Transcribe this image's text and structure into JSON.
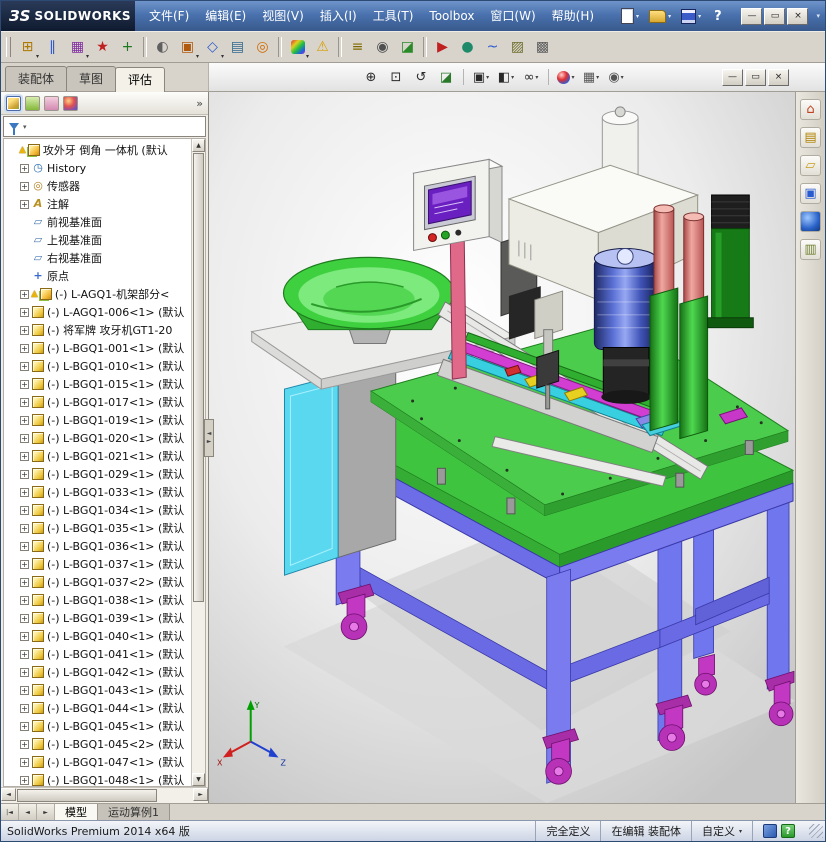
{
  "colors": {
    "titlebar_blue": "#4a72ae",
    "table_green": "#3fc43f",
    "frame_blue": "#7b7bf0",
    "caster_magenta": "#c238c2",
    "status_help_green": "#2a9a2a",
    "feeder_green": "#3fd03f",
    "motor_blue": "#5a6fd4",
    "door_cyan": "#5ad8f0"
  },
  "glyphs": {
    "caret": "▾",
    "overflow": "»",
    "up": "▲",
    "down": "▼",
    "left": "◄",
    "right": "►",
    "split_left": "◄",
    "split_right": "►"
  },
  "titlebar": {
    "brand_mark": "ЗS",
    "brand_name": "SOLIDWORKS",
    "menus": [
      "文件(F)",
      "编辑(E)",
      "视图(V)",
      "插入(I)",
      "工具(T)",
      "Toolbox",
      "窗口(W)",
      "帮助(H)"
    ],
    "quick_icons": [
      {
        "name": "new-document-button",
        "kind": "doc"
      },
      {
        "name": "open-document-button",
        "kind": "folder"
      },
      {
        "name": "save-button",
        "kind": "save"
      }
    ],
    "help_label": "?",
    "window_buttons": [
      "—",
      "▭",
      "×"
    ],
    "trailing_caret": "▾"
  },
  "toolbar": {
    "icons": [
      {
        "name": "insert-components-button",
        "glyph": "⊞",
        "color": "#b07800",
        "caret": true
      },
      {
        "name": "mate-button",
        "glyph": "∥",
        "color": "#2a5ad0"
      },
      {
        "name": "linear-component-pattern-button",
        "glyph": "▦",
        "color": "#8030a0",
        "caret": true
      },
      {
        "name": "smart-fasteners-button",
        "glyph": "★",
        "color": "#c02020"
      },
      {
        "name": "move-component-button",
        "glyph": "+",
        "color": "#207820"
      },
      {
        "sep": true
      },
      {
        "name": "show-hidden-components-button",
        "glyph": "◐",
        "color": "#606060"
      },
      {
        "name": "assembly-features-button",
        "glyph": "▣",
        "color": "#b05a10",
        "caret": true
      },
      {
        "name": "reference-geometry-button",
        "glyph": "◇",
        "color": "#2a5ad0",
        "caret": true
      },
      {
        "name": "bill-of-materials-button",
        "glyph": "▤",
        "color": "#306890"
      },
      {
        "name": "exploded-view-button",
        "glyph": "◎",
        "color": "#d06a00"
      },
      {
        "sep": true
      },
      {
        "name": "edit-appearance-button",
        "rainbow": true,
        "glyph": "",
        "caret": true
      },
      {
        "name": "interference-detection-button",
        "glyph": "⚠",
        "color": "#d8a000"
      },
      {
        "sep": true
      },
      {
        "name": "measure-button",
        "glyph": "≡",
        "color": "#806a00"
      },
      {
        "name": "mass-properties-button",
        "glyph": "◉",
        "color": "#505050"
      },
      {
        "name": "section-view-button",
        "glyph": "◪",
        "color": "#2a8a2a"
      },
      {
        "sep": true
      },
      {
        "name": "simulationxpress-button",
        "glyph": "▶",
        "color": "#c02020"
      },
      {
        "name": "motion-study-button",
        "glyph": "●",
        "color": "#1f8a6a"
      },
      {
        "name": "curves-button",
        "glyph": "~",
        "color": "#2a5ad0"
      },
      {
        "name": "toolbox-button",
        "glyph": "▨",
        "color": "#707030"
      },
      {
        "name": "options-button",
        "glyph": "▩",
        "color": "#606060"
      }
    ]
  },
  "command_tabs": {
    "items": [
      "装配体",
      "草图",
      "评估"
    ],
    "active_index": 2
  },
  "headsup": {
    "icons": [
      {
        "name": "zoom-to-fit-button",
        "glyph": "⊕",
        "color": "#2a2a2a"
      },
      {
        "name": "zoom-to-area-button",
        "glyph": "⊡",
        "color": "#2a2a2a"
      },
      {
        "name": "previous-view-button",
        "glyph": "↺",
        "color": "#2a2a2a"
      },
      {
        "name": "section-view-button",
        "glyph": "◪",
        "color": "#2a7a2a"
      },
      {
        "sep": true
      },
      {
        "name": "view-orientation-button",
        "glyph": "▣",
        "color": "#2a2a2a",
        "caret": true
      },
      {
        "name": "display-style-button",
        "glyph": "◧",
        "color": "#2a2a2a",
        "caret": true
      },
      {
        "name": "hide-show-items-button",
        "glyph": "∞",
        "color": "#2a2a2a",
        "caret": true
      },
      {
        "sep": true
      },
      {
        "name": "edit-appearance-button",
        "ball": true,
        "glyph": "",
        "caret": true
      },
      {
        "name": "apply-scene-button",
        "glyph": "▦",
        "color": "#555",
        "caret": true
      },
      {
        "name": "view-settings-button",
        "glyph": "◉",
        "color": "#555",
        "caret": true
      }
    ]
  },
  "child_window_buttons": [
    "—",
    "▭",
    "×"
  ],
  "feature_panel": {
    "tabs": [
      {
        "name": "featuremanager-tab"
      },
      {
        "name": "propertymanager-tab"
      },
      {
        "name": "configurationmanager-tab"
      },
      {
        "name": "displaymanager-tab"
      }
    ],
    "tree": {
      "items": [
        {
          "root": true,
          "icon": "assembly",
          "warn": true,
          "exp": false,
          "label": "攻外牙 倒角 一体机 (默认"
        },
        {
          "icon": "history",
          "exp": true,
          "label": "History"
        },
        {
          "icon": "sensor",
          "exp": true,
          "label": "传感器"
        },
        {
          "icon": "annotation",
          "exp": true,
          "label": "注解"
        },
        {
          "icon": "plane",
          "exp": false,
          "label": "前视基准面"
        },
        {
          "icon": "plane",
          "exp": false,
          "label": "上视基准面"
        },
        {
          "icon": "plane",
          "exp": false,
          "label": "右视基准面"
        },
        {
          "icon": "origin",
          "exp": false,
          "label": "原点"
        },
        {
          "icon": "assembly",
          "warn": true,
          "exp": true,
          "label": "(-) L-AGQ1-机架部分<"
        },
        {
          "icon": "part",
          "exp": true,
          "label": "(-) L-AGQ1-006<1> (默认"
        },
        {
          "icon": "part",
          "exp": true,
          "label": "(-) 将军牌 攻牙机GT1-20"
        },
        {
          "icon": "part",
          "exp": true,
          "label": "(-) L-BGQ1-001<1> (默认"
        },
        {
          "icon": "part",
          "exp": true,
          "label": "(-) L-BGQ1-010<1> (默认"
        },
        {
          "icon": "part",
          "exp": true,
          "label": "(-) L-BGQ1-015<1> (默认"
        },
        {
          "icon": "part",
          "exp": true,
          "label": "(-) L-BGQ1-017<1> (默认"
        },
        {
          "icon": "part",
          "exp": true,
          "label": "(-) L-BGQ1-019<1> (默认"
        },
        {
          "icon": "part",
          "exp": true,
          "label": "(-) L-BGQ1-020<1> (默认"
        },
        {
          "icon": "part",
          "exp": true,
          "label": "(-) L-BGQ1-021<1> (默认"
        },
        {
          "icon": "part",
          "exp": true,
          "label": "(-) L-BGQ1-029<1> (默认"
        },
        {
          "icon": "part",
          "exp": true,
          "label": "(-) L-BGQ1-033<1> (默认"
        },
        {
          "icon": "part",
          "exp": true,
          "label": "(-) L-BGQ1-034<1> (默认"
        },
        {
          "icon": "part",
          "exp": true,
          "label": "(-) L-BGQ1-035<1> (默认"
        },
        {
          "icon": "part",
          "exp": true,
          "label": "(-) L-BGQ1-036<1> (默认"
        },
        {
          "icon": "part",
          "exp": true,
          "label": "(-) L-BGQ1-037<1> (默认"
        },
        {
          "icon": "part",
          "exp": true,
          "label": "(-) L-BGQ1-037<2> (默认"
        },
        {
          "icon": "part",
          "exp": true,
          "label": "(-) L-BGQ1-038<1> (默认"
        },
        {
          "icon": "part",
          "exp": true,
          "label": "(-) L-BGQ1-039<1> (默认"
        },
        {
          "icon": "part",
          "exp": true,
          "label": "(-) L-BGQ1-040<1> (默认"
        },
        {
          "icon": "part",
          "exp": true,
          "label": "(-) L-BGQ1-041<1> (默认"
        },
        {
          "icon": "part",
          "exp": true,
          "label": "(-) L-BGQ1-042<1> (默认"
        },
        {
          "icon": "part",
          "exp": true,
          "label": "(-) L-BGQ1-043<1> (默认"
        },
        {
          "icon": "part",
          "exp": true,
          "label": "(-) L-BGQ1-044<1> (默认"
        },
        {
          "icon": "part",
          "exp": true,
          "label": "(-) L-BGQ1-045<1> (默认"
        },
        {
          "icon": "part",
          "exp": true,
          "label": "(-) L-BGQ1-045<2> (默认"
        },
        {
          "icon": "part",
          "exp": true,
          "label": "(-) L-BGQ1-047<1> (默认"
        },
        {
          "icon": "part",
          "exp": true,
          "label": "(-) L-BGQ1-048<1> (默认"
        }
      ]
    }
  },
  "taskpane": {
    "icons": [
      {
        "name": "solidworks-resources-button",
        "glyph": "⌂",
        "color": "#c04020"
      },
      {
        "name": "design-library-button",
        "glyph": "▤",
        "color": "#b08000"
      },
      {
        "name": "file-explorer-button",
        "glyph": "▱",
        "color": "#c8a020"
      },
      {
        "name": "view-palette-button",
        "glyph": "▣",
        "color": "#2a5ad0"
      },
      {
        "name": "appearances-scenes-button",
        "ball": true,
        "glyph": ""
      },
      {
        "name": "custom-properties-button",
        "glyph": "▥",
        "color": "#708030"
      }
    ]
  },
  "viewport": {
    "triad": {
      "x": "X",
      "y": "Y",
      "z": "Z"
    }
  },
  "bottom_bar": {
    "nav": [
      "|◄",
      "◄",
      "►"
    ],
    "tabs": [
      "模型",
      "运动算例1"
    ],
    "active_index": 0
  },
  "statusbar": {
    "app": "SolidWorks Premium 2014 x64 版",
    "define_state": "完全定义",
    "edit_state": "在编辑 装配体",
    "custom": "自定义",
    "help_label": "?"
  }
}
